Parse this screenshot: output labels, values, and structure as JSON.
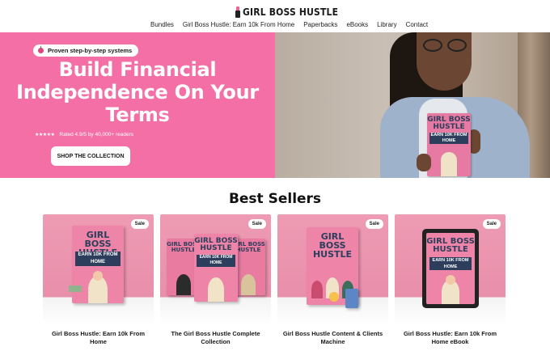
{
  "header": {
    "logo_text": "GIRL BOSS HUSTLE",
    "nav": [
      "Bundles",
      "Girl Boss Hustle: Earn 10k From Home",
      "Paperbacks",
      "eBooks",
      "Library",
      "Contact"
    ]
  },
  "hero": {
    "pill_text": "Proven step-by-step systems",
    "title_lines": [
      "Build Financial",
      "Independence On Your",
      "Terms"
    ],
    "stars": "★★★★★",
    "rating_text": "Rated 4.9/5 by 40,000+ readers",
    "cta_label": "SHOP THE COLLECTION",
    "book": {
      "title": "GIRL BOSS HUSTLE",
      "subtitle": "EARN 10K FROM HOME"
    },
    "colors": {
      "background": "#f46fa6"
    }
  },
  "section": {
    "title": "Best Sellers"
  },
  "products": [
    {
      "badge": "Sale",
      "title": "Girl Boss Hustle: Earn 10k From Home",
      "cover_title": "GIRL BOSS HUSTLE",
      "cover_band": "EARN 10K FROM HOME"
    },
    {
      "badge": "Sale",
      "title": "The Girl Boss Hustle Complete Collection",
      "cover_title": "GIRL BOSS HUSTLE",
      "cover_band": "EARN 10K FROM HOME"
    },
    {
      "badge": "Sale",
      "title": "Girl Boss Hustle Content & Clients Machine",
      "cover_title": "GIRL BOSS HUSTLE",
      "cover_band": ""
    },
    {
      "badge": "Sale",
      "title": "Girl Boss Hustle: Earn 10k From Home eBook",
      "cover_title": "GIRL BOSS HUSTLE",
      "cover_band": "EARN 10K FROM HOME"
    }
  ]
}
